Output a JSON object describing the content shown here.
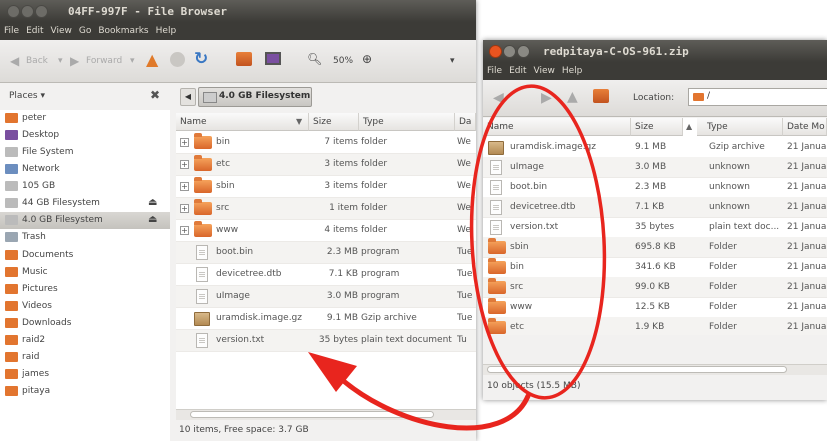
{
  "left_window": {
    "title": "04FF-997F - File Browser",
    "menu": [
      "File",
      "Edit",
      "View",
      "Go",
      "Bookmarks",
      "Help"
    ],
    "toolbar": {
      "back": "Back",
      "forward": "Forward",
      "zoom": "50%"
    },
    "places_label": "Places ▾",
    "location_crumb": "4.0 GB Filesystem",
    "columns": [
      "Name",
      "Size",
      "Type",
      "Da"
    ],
    "places": [
      {
        "label": "peter",
        "icon": "home-folder-icon"
      },
      {
        "label": "Desktop",
        "icon": "desktop-icon"
      },
      {
        "label": "File System",
        "icon": "drive-icon"
      },
      {
        "label": "Network",
        "icon": "network-icon"
      },
      {
        "label": "105 GB",
        "icon": "drive-icon"
      },
      {
        "label": "44 GB Filesystem",
        "icon": "drive-icon",
        "eject": true
      },
      {
        "label": "4.0 GB Filesystem",
        "icon": "drive-icon",
        "eject": true,
        "selected": true
      },
      {
        "label": "Trash",
        "icon": "trash-icon"
      },
      {
        "label": "Documents",
        "icon": "documents-folder-icon"
      },
      {
        "label": "Music",
        "icon": "music-folder-icon"
      },
      {
        "label": "Pictures",
        "icon": "pictures-folder-icon"
      },
      {
        "label": "Videos",
        "icon": "videos-folder-icon"
      },
      {
        "label": "Downloads",
        "icon": "downloads-folder-icon"
      },
      {
        "label": "raid2",
        "icon": "folder-icon"
      },
      {
        "label": "raid",
        "icon": "folder-icon"
      },
      {
        "label": "james",
        "icon": "folder-icon"
      },
      {
        "label": "pitaya",
        "icon": "folder-icon"
      }
    ],
    "files": [
      {
        "name": "bin",
        "size": "7 items",
        "type": "folder",
        "date": "We",
        "kind": "folder"
      },
      {
        "name": "etc",
        "size": "3 items",
        "type": "folder",
        "date": "We",
        "kind": "folder"
      },
      {
        "name": "sbin",
        "size": "3 items",
        "type": "folder",
        "date": "We",
        "kind": "folder"
      },
      {
        "name": "src",
        "size": "1 item",
        "type": "folder",
        "date": "We",
        "kind": "folder"
      },
      {
        "name": "www",
        "size": "4 items",
        "type": "folder",
        "date": "We",
        "kind": "folder"
      },
      {
        "name": "boot.bin",
        "size": "2.3 MB",
        "type": "program",
        "date": "Tue",
        "kind": "file"
      },
      {
        "name": "devicetree.dtb",
        "size": "7.1 KB",
        "type": "program",
        "date": "Tue",
        "kind": "file"
      },
      {
        "name": "uImage",
        "size": "3.0 MB",
        "type": "program",
        "date": "Tue",
        "kind": "file"
      },
      {
        "name": "uramdisk.image.gz",
        "size": "9.1 MB",
        "type": "Gzip archive",
        "date": "Tue",
        "kind": "archive"
      },
      {
        "name": "version.txt",
        "size": "35 bytes",
        "type": "plain text document",
        "date": "Tu",
        "kind": "file"
      }
    ],
    "status": "10 items, Free space: 3.7 GB"
  },
  "right_window": {
    "title": "redpitaya-C-OS-961.zip",
    "menu": [
      "File",
      "Edit",
      "View",
      "Help"
    ],
    "location_label": "Location:",
    "location_value": "/",
    "columns": [
      "Name",
      "Size",
      "Type",
      "Date Mo"
    ],
    "files": [
      {
        "name": "uramdisk.image.gz",
        "size": "9.1 MB",
        "type": "Gzip archive",
        "date": "21 Janua",
        "kind": "archive"
      },
      {
        "name": "uImage",
        "size": "3.0 MB",
        "type": "unknown",
        "date": "21 Janua",
        "kind": "file"
      },
      {
        "name": "boot.bin",
        "size": "2.3 MB",
        "type": "unknown",
        "date": "21 Janua",
        "kind": "file"
      },
      {
        "name": "devicetree.dtb",
        "size": "7.1 KB",
        "type": "unknown",
        "date": "21 Janua",
        "kind": "file"
      },
      {
        "name": "version.txt",
        "size": "35 bytes",
        "type": "plain text doc...",
        "date": "21 Janua",
        "kind": "file"
      },
      {
        "name": "sbin",
        "size": "695.8 KB",
        "type": "Folder",
        "date": "21 Janua",
        "kind": "folder"
      },
      {
        "name": "bin",
        "size": "341.6 KB",
        "type": "Folder",
        "date": "21 Janua",
        "kind": "folder"
      },
      {
        "name": "src",
        "size": "99.0 KB",
        "type": "Folder",
        "date": "21 Janua",
        "kind": "folder"
      },
      {
        "name": "www",
        "size": "12.5 KB",
        "type": "Folder",
        "date": "21 Janua",
        "kind": "folder"
      },
      {
        "name": "etc",
        "size": "1.9 KB",
        "type": "Folder",
        "date": "21 Janua",
        "kind": "folder"
      }
    ],
    "status": "10 objects (15.5 MB)"
  },
  "annotation": {
    "color": "#e8251e"
  }
}
